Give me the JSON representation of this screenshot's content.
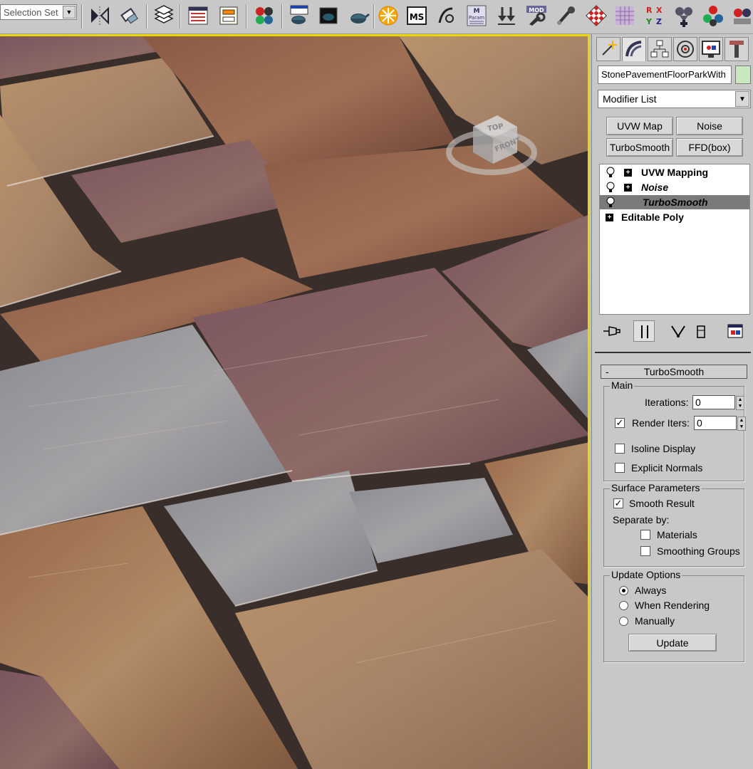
{
  "toolbar": {
    "selection_set": "Selection Set",
    "icons": [
      "mirror-icon",
      "align-icon",
      "layer-manager-icon",
      "curve-editor-icon",
      "schematic-view-icon",
      "material-editor-icon",
      "render-setup-icon",
      "rendered-frame-window-icon",
      "quick-render-icon",
      "sun-icon",
      "maxscript-icon",
      "reaction-icon",
      "param-editor-icon",
      "collapse-icon",
      "modifier-icon",
      "brush-icon",
      "checker-map-icon",
      "grid-icon",
      "xyz-transform-icon",
      "spacewarp-plus-icon",
      "particle-view-icon",
      "custom-icon"
    ],
    "maxscript_label": "MS",
    "param_label": "Param",
    "mod_label": "MOD",
    "xyz_labels": [
      "R",
      "X",
      "Y",
      "Z"
    ]
  },
  "viewcube": {
    "top": "TOP",
    "front": "FRONT"
  },
  "command_panel": {
    "object_name": "StonePavementFloorParkWith",
    "object_color": "#c8e8c0",
    "modifier_list": "Modifier List",
    "quick_buttons": [
      "UVW Map",
      "Noise",
      "TurboSmooth",
      "FFD(box)"
    ],
    "stack": [
      {
        "label": "UVW Mapping",
        "italic": false,
        "selected": false,
        "has_bulb": true,
        "expandable": true
      },
      {
        "label": "Noise",
        "italic": true,
        "selected": false,
        "has_bulb": true,
        "expandable": true
      },
      {
        "label": "TurboSmooth",
        "italic": true,
        "selected": true,
        "has_bulb": true,
        "expandable": false
      },
      {
        "label": "Editable Poly",
        "italic": false,
        "selected": false,
        "has_bulb": false,
        "expandable": true
      }
    ]
  },
  "turbosmooth": {
    "title": "TurboSmooth",
    "collapse": "-",
    "main": {
      "title": "Main",
      "iterations_label": "Iterations:",
      "iterations_value": "0",
      "render_iters_label": "Render Iters:",
      "render_iters_value": "0",
      "render_iters_checked": true,
      "isoline_label": "Isoline Display",
      "isoline_checked": false,
      "explicit_normals_label": "Explicit Normals",
      "explicit_normals_checked": false
    },
    "surface": {
      "title": "Surface Parameters",
      "smooth_result_label": "Smooth Result",
      "smooth_result_checked": true,
      "separate_by_label": "Separate by:",
      "materials_label": "Materials",
      "materials_checked": false,
      "smoothing_groups_label": "Smoothing Groups",
      "smoothing_groups_checked": false
    },
    "update": {
      "title": "Update Options",
      "always_label": "Always",
      "when_rendering_label": "When Rendering",
      "manually_label": "Manually",
      "selected": "always",
      "update_button": "Update"
    }
  }
}
